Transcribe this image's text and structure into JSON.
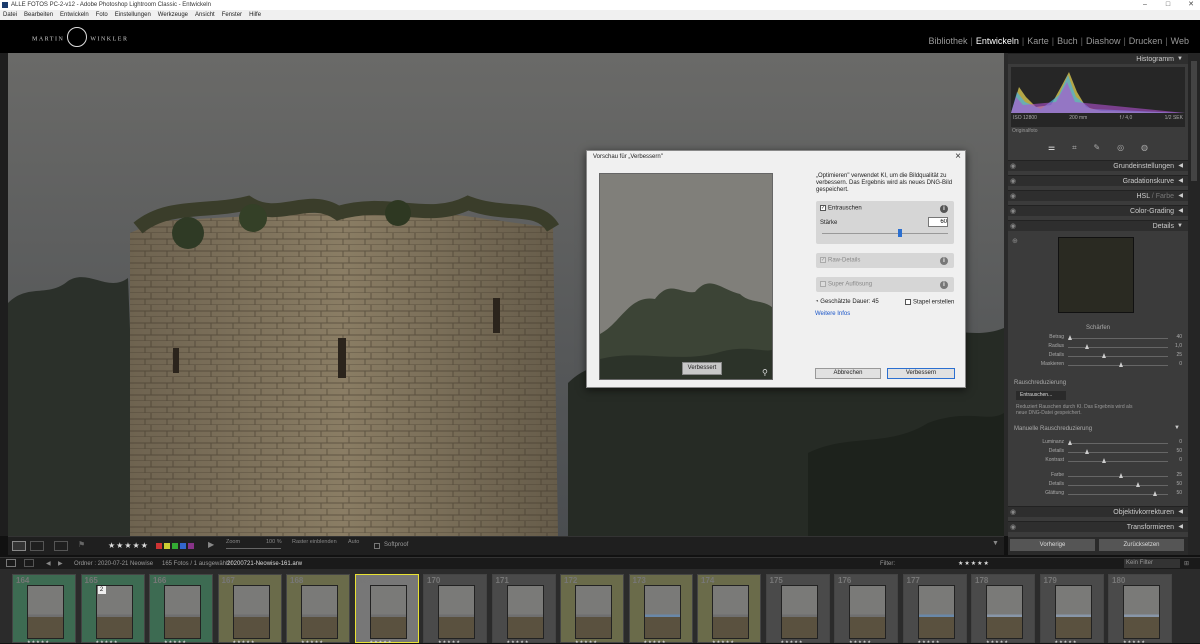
{
  "window": {
    "title": "ALLE FOTOS PC-2-v12 - Adobe Photoshop Lightroom Classic - Entwickeln"
  },
  "menu": [
    "Datei",
    "Bearbeiten",
    "Entwickeln",
    "Foto",
    "Einstellungen",
    "Werkzeuge",
    "Ansicht",
    "Fenster",
    "Hilfe"
  ],
  "logo": {
    "left": "MARTIN",
    "right": "WINKLER"
  },
  "modules": [
    "Bibliothek",
    "Entwickeln",
    "Karte",
    "Buch",
    "Diashow",
    "Drucken",
    "Web"
  ],
  "active_module": "Entwickeln",
  "histogram": {
    "title": "Histogramm",
    "iso": "ISO 12800",
    "focal": "200 mm",
    "aperture": "f / 4,0",
    "shutter": "1/2 SEK",
    "original": "Originalfoto"
  },
  "panels": {
    "grund": "Grundeinstellungen",
    "gradation": "Gradationskurve",
    "hsl": "HSL",
    "farbe": "Farbe",
    "hsl_sep": "/",
    "colorgrading": "Color-Grading",
    "details": "Details",
    "objektiv": "Objektivkorrekturen",
    "transform": "Transformieren"
  },
  "sharpen": {
    "title": "Schärfen",
    "rows": [
      {
        "label": "Betrag",
        "value": "40"
      },
      {
        "label": "Radius",
        "value": "1,0"
      },
      {
        "label": "Details",
        "value": "25"
      },
      {
        "label": "Maskieren",
        "value": "0"
      }
    ]
  },
  "noise": {
    "title": "Rauschreduzierung",
    "button": "Entrauschen...",
    "desc": "Reduziert Rauschen durch KI. Das Ergebnis wird als neue DNG-Datei gespeichert.",
    "manual": "Manuelle Rauschreduzierung",
    "rows": [
      {
        "label": "Luminanz",
        "value": "0"
      },
      {
        "label": "Details",
        "value": "50"
      },
      {
        "label": "Kontrast",
        "value": "0"
      },
      {
        "label": "Farbe",
        "value": "25"
      },
      {
        "label": "Details",
        "value": "50"
      },
      {
        "label": "Glättung",
        "value": "50"
      }
    ]
  },
  "panel_buttons": {
    "prev": "Vorherige",
    "reset": "Zurücksetzen"
  },
  "toolbar": {
    "zoom_label": "Zoom",
    "zoom_value": "100 %",
    "raster": "Raster einblenden",
    "auto": "Auto",
    "softproof": "Softproof",
    "stars": "★★★★★"
  },
  "filmheader": {
    "folder": "Ordner : 2020-07-21 Neowise",
    "count": "165 Fotos / 1 ausgewählt /",
    "file": "20200721-Neowise-161.arw",
    "filter_label": "Filter:",
    "filter_value": "Kein Filter",
    "page1": "1",
    "page2": "2"
  },
  "dialog": {
    "title": "Vorschau für „Verbessern\"",
    "intro": "„Optimieren\" verwendet KI, um die Bildqualität zu verbessern. Das Ergebnis wird als neues DNG-Bild gespeichert.",
    "denoise_label": "Entrauschen",
    "strength_label": "Stärke",
    "strength_value": "60",
    "strength": 0.6,
    "raw_details": "Raw-Details",
    "super_res": "Super Auflösung",
    "duration": "Geschätzte Dauer: 45",
    "stack": "Stapel erstellen",
    "more_info": "Weitere Infos",
    "preview_badge": "Verbessert",
    "cancel": "Abbrechen",
    "ok": "Verbessern"
  },
  "filmstrip": [
    {
      "num": "164",
      "stars": "★★★★★"
    },
    {
      "num": "165",
      "stars": "★★★★★",
      "badge": "2"
    },
    {
      "num": "166",
      "stars": "★★★★★"
    },
    {
      "num": "167",
      "stars": "★★★★★"
    },
    {
      "num": "168",
      "stars": "★★★★★"
    },
    {
      "num": "169",
      "stars": "★★★★★"
    },
    {
      "num": "170",
      "stars": "★★★★★"
    },
    {
      "num": "171",
      "stars": "★★★★★"
    },
    {
      "num": "172",
      "stars": "★★★★★"
    },
    {
      "num": "173",
      "stars": "★★★★★"
    },
    {
      "num": "174",
      "stars": "★★★★★"
    },
    {
      "num": "175",
      "stars": "★★★★★"
    },
    {
      "num": "176",
      "stars": "★★★★★"
    },
    {
      "num": "177",
      "stars": "★★★★★"
    },
    {
      "num": "178",
      "stars": "★★★★★"
    },
    {
      "num": "179",
      "stars": "★★★★★"
    },
    {
      "num": "180",
      "stars": "★★★★★"
    }
  ],
  "colors": {
    "accent": "#3a74c7",
    "panel": "#3b3b3b",
    "selected_border": "#e8e233"
  }
}
